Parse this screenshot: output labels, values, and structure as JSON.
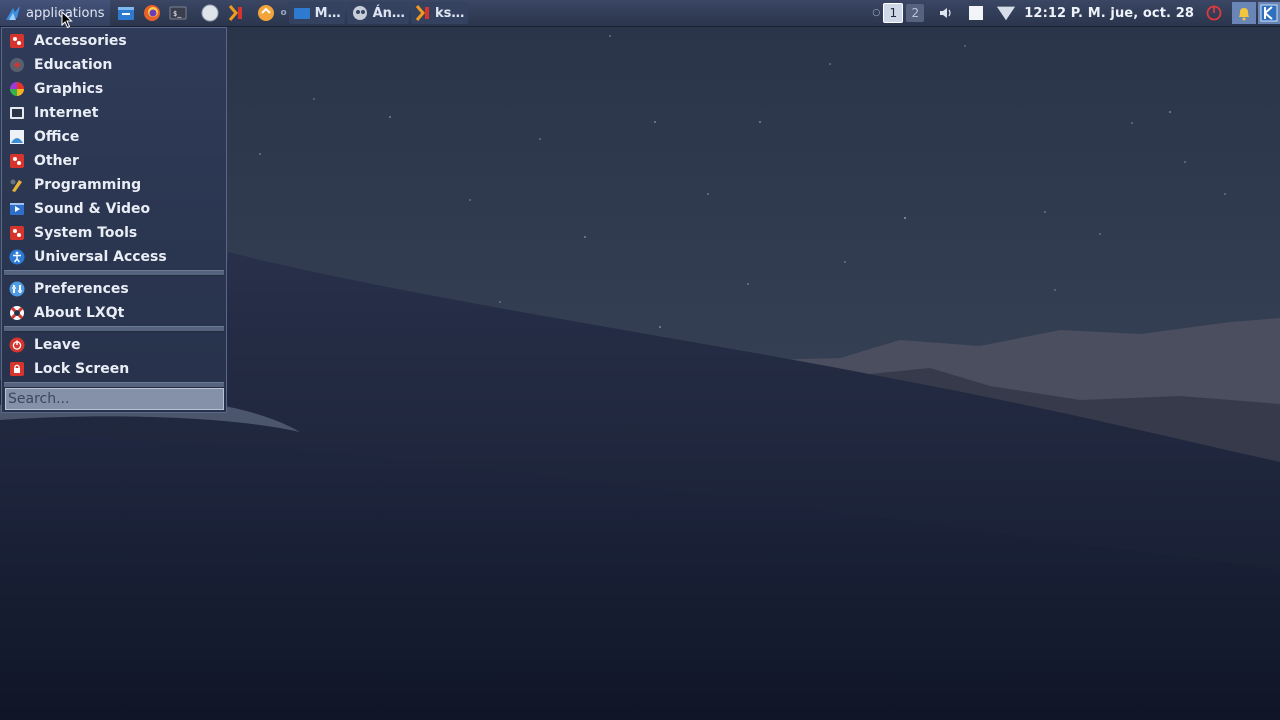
{
  "panel": {
    "menu_label": "applications",
    "tasks": [
      {
        "label": "M…",
        "icon": "folder-icon"
      },
      {
        "label": "Án…",
        "icon": "document-viewer-icon"
      },
      {
        "label": "ks…",
        "icon": "terminal-icon"
      }
    ],
    "tray_indicator": "○",
    "workspaces": [
      "1",
      "2"
    ],
    "clock": "12:12 P. M. jue, oct. 28"
  },
  "menu": {
    "categories": [
      {
        "label": "Accessories",
        "icon": "accessories-icon"
      },
      {
        "label": "Education",
        "icon": "education-icon"
      },
      {
        "label": "Graphics",
        "icon": "graphics-icon"
      },
      {
        "label": "Internet",
        "icon": "internet-icon"
      },
      {
        "label": "Office",
        "icon": "office-icon"
      },
      {
        "label": "Other",
        "icon": "other-icon"
      },
      {
        "label": "Programming",
        "icon": "programming-icon"
      },
      {
        "label": "Sound & Video",
        "icon": "sound-video-icon"
      },
      {
        "label": "System Tools",
        "icon": "system-tools-icon"
      },
      {
        "label": "Universal Access",
        "icon": "universal-access-icon"
      }
    ],
    "settings": [
      {
        "label": "Preferences",
        "icon": "preferences-icon"
      },
      {
        "label": "About LXQt",
        "icon": "lifebuoy-icon"
      }
    ],
    "session": [
      {
        "label": "Leave",
        "icon": "power-icon"
      },
      {
        "label": "Lock Screen",
        "icon": "lock-icon"
      }
    ],
    "search_placeholder": "Search..."
  },
  "colors": {
    "panel_bg": "#2b354d",
    "menu_bg": "#2f3b58",
    "accent_red": "#d6342c",
    "accent_blue": "#2b7bd6"
  }
}
